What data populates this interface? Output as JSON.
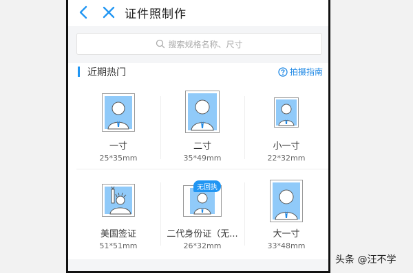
{
  "header": {
    "title": "证件照制作"
  },
  "search": {
    "placeholder": "搜索规格名称、尺寸"
  },
  "section": {
    "title": "近期热门",
    "guide_label": "拍摄指南"
  },
  "sizes": [
    {
      "name": "一寸",
      "size": "25*35mm"
    },
    {
      "name": "二寸",
      "size": "35*49mm"
    },
    {
      "name": "小一寸",
      "size": "22*32mm"
    },
    {
      "name": "美国签证",
      "size": "51*51mm"
    },
    {
      "name": "二代身份证（无...",
      "size": "26*32mm",
      "badge": "无回执"
    },
    {
      "name": "大一寸",
      "size": "33*48mm"
    }
  ],
  "watermark": "头条 @汪不学",
  "colors": {
    "accent": "#2196f3",
    "photo_bg": "#90caf9"
  }
}
